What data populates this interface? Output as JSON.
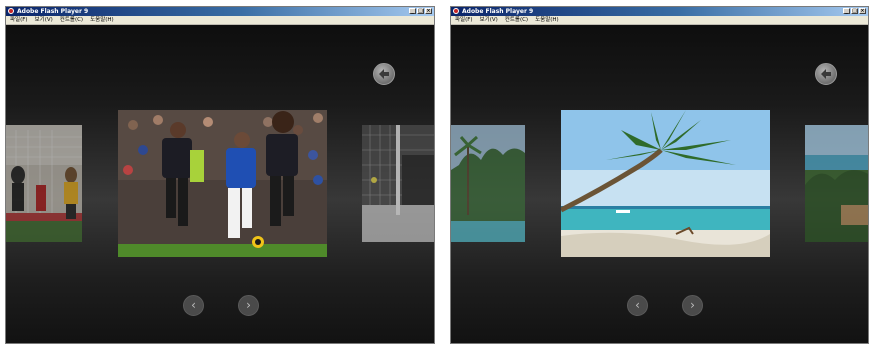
{
  "windows": [
    {
      "title": "Adobe Flash Player 9",
      "menu": [
        "파일(F)",
        "보기(V)",
        "컨트롤(C)",
        "도움말(H)"
      ],
      "theme": "soccer"
    },
    {
      "title": "Adobe Flash Player 9",
      "menu": [
        "파일(F)",
        "보기(V)",
        "컨트롤(C)",
        "도움말(H)"
      ],
      "theme": "beach"
    }
  ],
  "titlebar_buttons": [
    "_",
    "□",
    "×"
  ],
  "nav": {
    "prev_glyph": "‹",
    "next_glyph": "›"
  },
  "colors": {
    "titlebar_start": "#0a246a",
    "titlebar_end": "#a6caf0",
    "stage_dark": "#121212",
    "stage_mid": "#383838",
    "nav_button": "#4a4a4a"
  },
  "icons": {
    "back": "back-arrow-icon",
    "prev": "chevron-left-icon",
    "next": "chevron-right-icon",
    "app": "flash-player-icon"
  }
}
